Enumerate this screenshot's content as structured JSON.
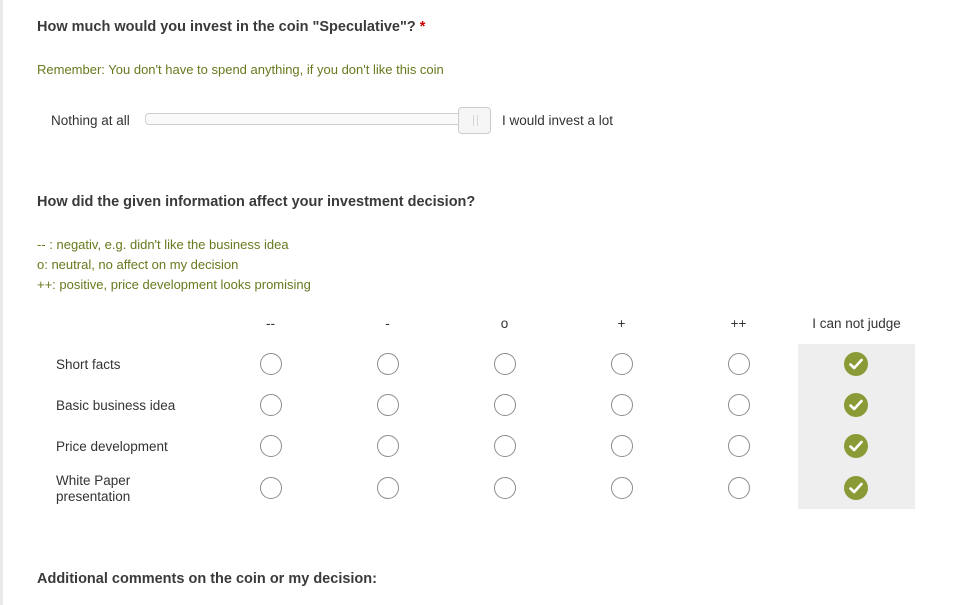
{
  "q1": {
    "title": "How much would you invest in the coin \"Speculative\"?",
    "required_mark": "*",
    "help": "Remember: You don't have to spend anything, if you don't like this coin",
    "slider": {
      "min_label": "Nothing at all",
      "max_label": "I would invest a lot",
      "value_fraction": 1.0
    }
  },
  "q2": {
    "title": "How did the given information affect your investment decision?",
    "help_lines": [
      "-- : negativ, e.g. didn't like the business idea",
      "o: neutral, no affect on my decision",
      "++: positive, price development looks promising"
    ],
    "columns": [
      "--",
      "-",
      "o",
      "+",
      "++",
      "I can not judge"
    ],
    "rows": [
      {
        "label": "Short facts",
        "selected": "I can not judge"
      },
      {
        "label": "Basic business idea",
        "selected": "I can not judge"
      },
      {
        "label": "Price development",
        "selected": "I can not judge"
      },
      {
        "label": "White Paper presentation",
        "selected": "I can not judge"
      }
    ],
    "checked_color": "#8a9a36"
  },
  "q3": {
    "title": "Additional comments on the coin or my decision:"
  }
}
